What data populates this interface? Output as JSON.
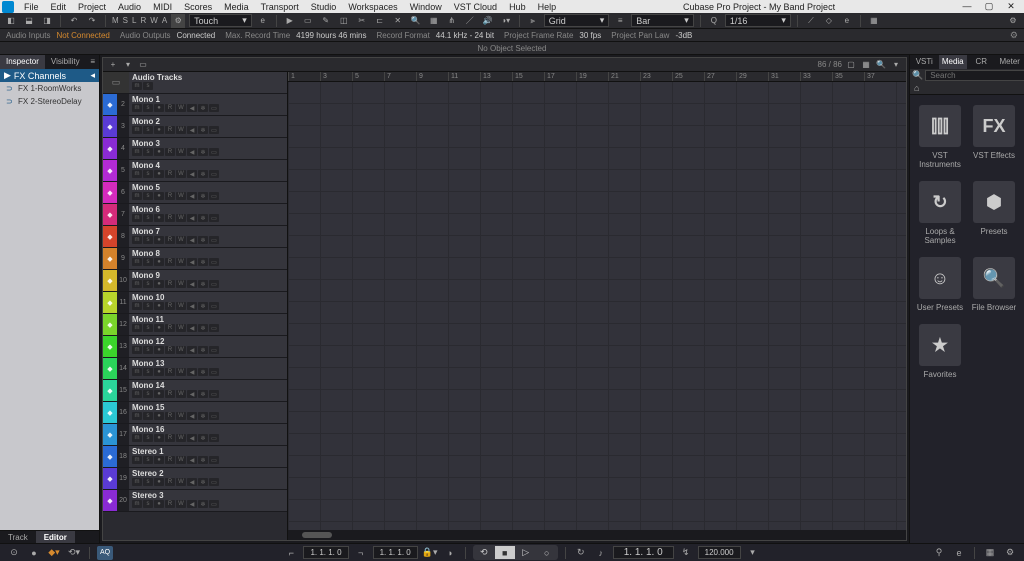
{
  "menu": {
    "items": [
      "File",
      "Edit",
      "Project",
      "Audio",
      "MIDI",
      "Scores",
      "Media",
      "Transport",
      "Studio",
      "Workspaces",
      "Window",
      "VST Cloud",
      "Hub",
      "Help"
    ]
  },
  "title": "Cubase Pro Project - My Band Project",
  "toolbar": {
    "m": "M",
    "s": "S",
    "l": "L",
    "r": "R",
    "w": "W",
    "a": "A",
    "automation": "Touch",
    "snap": "Grid",
    "snap_mode": "Bar",
    "quantize": "1/16"
  },
  "status": {
    "audio_inputs_lbl": "Audio Inputs",
    "audio_inputs_val": "Not Connected",
    "audio_outputs_lbl": "Audio Outputs",
    "audio_outputs_val": "Connected",
    "maxrec_lbl": "Max. Record Time",
    "maxrec_val": "4199 hours 46 mins",
    "recfmt_lbl": "Record Format",
    "recfmt_val": "44.1 kHz - 24 bit",
    "frate_lbl": "Project Frame Rate",
    "frate_val": "30 fps",
    "pan_lbl": "Project Pan Law",
    "pan_val": "-3dB"
  },
  "noobj": "No Object Selected",
  "inspector": {
    "tab_inspector": "Inspector",
    "tab_visibility": "Visibility",
    "fx_header": "FX Channels",
    "fx_items": [
      "FX 1-RoomWorks",
      "FX 2-StereoDelay"
    ],
    "tab_track": "Track",
    "tab_editor": "Editor"
  },
  "arrange": {
    "bar_count": "86 / 86",
    "folder_name": "Audio Tracks",
    "ruler_marks": [
      1,
      3,
      5,
      7,
      9,
      11,
      13,
      15,
      17,
      19,
      21,
      23,
      25,
      27,
      29,
      31,
      33,
      35,
      37
    ],
    "tracks": [
      {
        "n": 2,
        "name": "Mono 1",
        "color": "#2b6bd4"
      },
      {
        "n": 3,
        "name": "Mono 2",
        "color": "#5a3bd4"
      },
      {
        "n": 4,
        "name": "Mono 3",
        "color": "#8a2bd4"
      },
      {
        "n": 5,
        "name": "Mono 4",
        "color": "#b22bd4"
      },
      {
        "n": 6,
        "name": "Mono 5",
        "color": "#d42bbd"
      },
      {
        "n": 7,
        "name": "Mono 6",
        "color": "#d42b7a"
      },
      {
        "n": 8,
        "name": "Mono 7",
        "color": "#d4442b"
      },
      {
        "n": 9,
        "name": "Mono 8",
        "color": "#d4822b"
      },
      {
        "n": 10,
        "name": "Mono 9",
        "color": "#d4b82b"
      },
      {
        "n": 11,
        "name": "Mono 10",
        "color": "#b8d42b"
      },
      {
        "n": 12,
        "name": "Mono 11",
        "color": "#7ad42b"
      },
      {
        "n": 13,
        "name": "Mono 12",
        "color": "#3bd42b"
      },
      {
        "n": 14,
        "name": "Mono 13",
        "color": "#2bd45a"
      },
      {
        "n": 15,
        "name": "Mono 14",
        "color": "#2bd49a"
      },
      {
        "n": 16,
        "name": "Mono 15",
        "color": "#2bc8d4"
      },
      {
        "n": 17,
        "name": "Mono 16",
        "color": "#2b94d4"
      },
      {
        "n": 18,
        "name": "Stereo 1",
        "color": "#2b6bd4"
      },
      {
        "n": 19,
        "name": "Stereo 2",
        "color": "#5a3bd4"
      },
      {
        "n": 20,
        "name": "Stereo 3",
        "color": "#8a2bd4"
      }
    ]
  },
  "media": {
    "tabs": [
      "VSTi",
      "Media",
      "CR",
      "Meter"
    ],
    "search_placeholder": "Search",
    "cards": [
      {
        "icon": "⫿⫿⫿",
        "label": "VST Instruments"
      },
      {
        "icon": "FX",
        "label": "VST Effects"
      },
      {
        "icon": "↻",
        "label": "Loops & Samples"
      },
      {
        "icon": "⬢",
        "label": "Presets"
      },
      {
        "icon": "☺",
        "label": "User Presets"
      },
      {
        "icon": "🔍",
        "label": "File Browser"
      },
      {
        "icon": "★",
        "label": "Favorites"
      }
    ]
  },
  "transport": {
    "left_marker": "1. 1. 1.   0",
    "right_marker": "1. 1. 1.   0",
    "primary": "1.  1.  1.    0",
    "tempo": "120.000",
    "sig": "♪"
  }
}
